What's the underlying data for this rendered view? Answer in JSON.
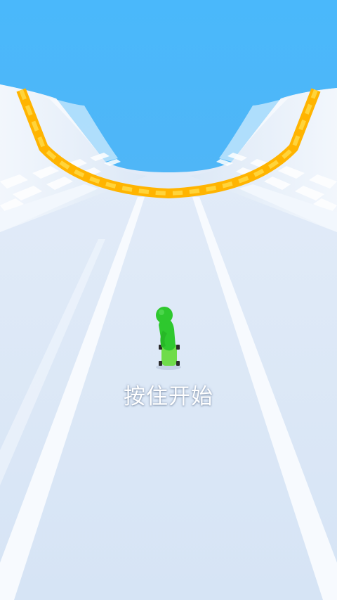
{
  "game": {
    "prompt_text": "按住开始"
  },
  "colors": {
    "sky": "#4ab8fb",
    "track": "#dbe7f6",
    "rail_orange": "#ffb400",
    "rail_yellow": "#ffd43b",
    "player": "#2ec82e",
    "skateboard": "#6fdc4a"
  }
}
